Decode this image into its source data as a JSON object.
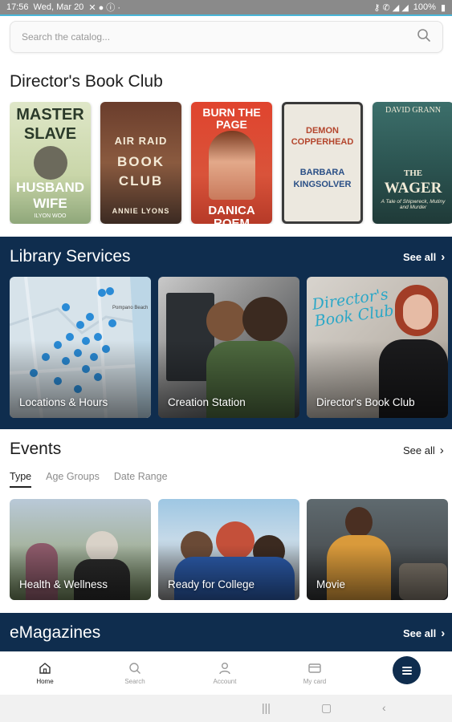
{
  "status_bar": {
    "time": "17:56",
    "date": "Wed, Mar 20",
    "battery": "100%"
  },
  "search": {
    "placeholder": "Search the catalog..."
  },
  "book_club": {
    "title": "Director's Book Club",
    "books": [
      {
        "line1": "MASTER",
        "line2": "SLAVE",
        "line3": "HUSBAND",
        "line4": "WIFE",
        "author": "ILYON WOO"
      },
      {
        "line1": "AIR RAID",
        "line2": "BOOK",
        "line3": "CLUB",
        "author": "ANNIE LYONS"
      },
      {
        "line1": "BURN THE PAGE",
        "author": "DANICA ROEM"
      },
      {
        "line1": "DEMON",
        "line2": "COPPERHEAD",
        "author1": "BARBARA",
        "author2": "KINGSOLVER"
      },
      {
        "author": "DAVID GRANN",
        "line1": "THE",
        "line2": "WAGER",
        "line3": "A Tale of Shipwreck, Mutiny and Murder"
      }
    ]
  },
  "library_services": {
    "title": "Library Services",
    "see_all": "See all",
    "cards": [
      {
        "label": "Locations & Hours",
        "map_text": "Pompano Beach"
      },
      {
        "label": "Creation Station"
      },
      {
        "label": "Director's Book Club",
        "overlay_text": "Director's Book Club"
      }
    ]
  },
  "events": {
    "title": "Events",
    "see_all": "See all",
    "tabs": [
      {
        "label": "Type",
        "active": true
      },
      {
        "label": "Age Groups",
        "active": false
      },
      {
        "label": "Date Range",
        "active": false
      }
    ],
    "cards": [
      {
        "label": "Health & Wellness"
      },
      {
        "label": "Ready for College"
      },
      {
        "label": "Movie"
      }
    ]
  },
  "emagazines": {
    "title": "eMagazines",
    "see_all": "See all"
  },
  "bottom_nav": {
    "items": [
      {
        "label": "Home",
        "icon": "home-icon"
      },
      {
        "label": "Search",
        "icon": "search-icon"
      },
      {
        "label": "Account",
        "icon": "account-icon"
      },
      {
        "label": "My card",
        "icon": "card-icon"
      }
    ],
    "menu_icon": "menu-icon"
  },
  "colors": {
    "navy": "#0f2d4e",
    "accent": "#4ab6d8"
  }
}
